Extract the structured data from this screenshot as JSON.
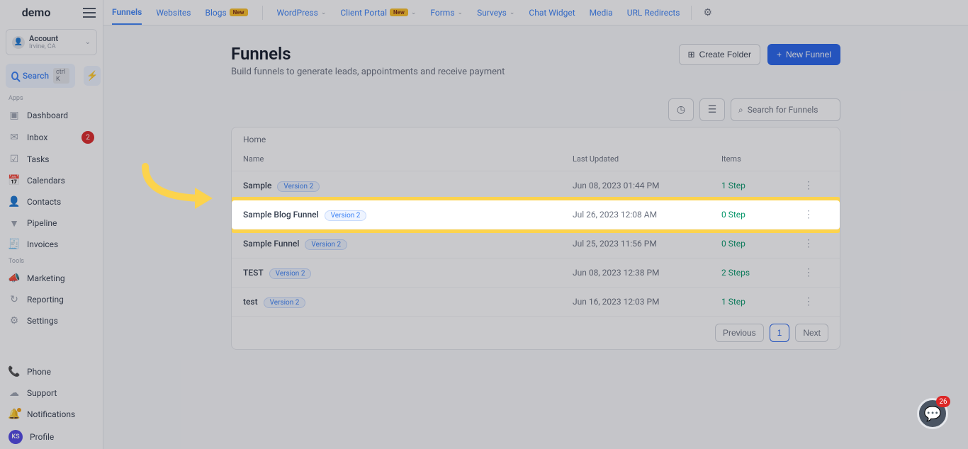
{
  "brand": "demo",
  "account": {
    "name": "Account",
    "sub": "Irvine, CA"
  },
  "search": {
    "label": "Search",
    "shortcut": "ctrl K"
  },
  "sections": {
    "apps_label": "Apps",
    "tools_label": "Tools"
  },
  "sidebar": {
    "apps": [
      {
        "icon": "▣",
        "label": "Dashboard",
        "name": "dashboard"
      },
      {
        "icon": "✉",
        "label": "Inbox",
        "name": "inbox",
        "badge": "2"
      },
      {
        "icon": "☑",
        "label": "Tasks",
        "name": "tasks"
      },
      {
        "icon": "📅",
        "label": "Calendars",
        "name": "calendars"
      },
      {
        "icon": "👤",
        "label": "Contacts",
        "name": "contacts"
      },
      {
        "icon": "▼",
        "label": "Pipeline",
        "name": "pipeline"
      },
      {
        "icon": "🧾",
        "label": "Invoices",
        "name": "invoices"
      }
    ],
    "tools": [
      {
        "icon": "📣",
        "label": "Marketing",
        "name": "marketing"
      },
      {
        "icon": "↻",
        "label": "Reporting",
        "name": "reporting"
      },
      {
        "icon": "⚙",
        "label": "Settings",
        "name": "settings"
      }
    ],
    "bottom": [
      {
        "icon": "📞",
        "label": "Phone",
        "name": "phone"
      },
      {
        "icon": "☁",
        "label": "Support",
        "name": "support"
      },
      {
        "icon": "🔔",
        "label": "Notifications",
        "name": "notifications",
        "dot": true
      },
      {
        "avatar": "KS",
        "label": "Profile",
        "name": "profile"
      }
    ]
  },
  "topnav": [
    {
      "label": "Funnels",
      "active": true
    },
    {
      "label": "Websites"
    },
    {
      "label": "Blogs",
      "new": true
    },
    {
      "label": "WordPress",
      "dropdown": true
    },
    {
      "label": "Client Portal",
      "new": true,
      "dropdown": true
    },
    {
      "label": "Forms",
      "dropdown": true
    },
    {
      "label": "Surveys",
      "dropdown": true
    },
    {
      "label": "Chat Widget"
    },
    {
      "label": "Media"
    },
    {
      "label": "URL Redirects"
    }
  ],
  "topnav_new_pill": "New",
  "page": {
    "title": "Funnels",
    "subtitle": "Build funnels to generate leads, appointments and receive payment",
    "create_folder": "Create Folder",
    "new_funnel": "New Funnel",
    "search_placeholder": "Search for Funnels"
  },
  "breadcrumb": "Home",
  "table": {
    "head": {
      "name": "Name",
      "updated": "Last Updated",
      "items": "Items"
    },
    "rows": [
      {
        "name": "Sample",
        "version": "Version 2",
        "updated": "Jun 08, 2023 01:44 PM",
        "items": "1 Step"
      },
      {
        "name": "Sample Blog Funnel",
        "version": "Version 2",
        "updated": "Jul 26, 2023 12:08 AM",
        "items": "0 Step",
        "highlight": true
      },
      {
        "name": "Sample Funnel",
        "version": "Version 2",
        "updated": "Jul 25, 2023 11:56 PM",
        "items": "0 Step"
      },
      {
        "name": "TEST",
        "version": "Version 2",
        "updated": "Jun 08, 2023 12:38 PM",
        "items": "2 Steps"
      },
      {
        "name": "test",
        "version": "Version 2",
        "updated": "Jun 16, 2023 12:03 PM",
        "items": "1 Step"
      }
    ]
  },
  "pager": {
    "previous": "Previous",
    "page": "1",
    "next": "Next"
  },
  "chat_badge": "26"
}
